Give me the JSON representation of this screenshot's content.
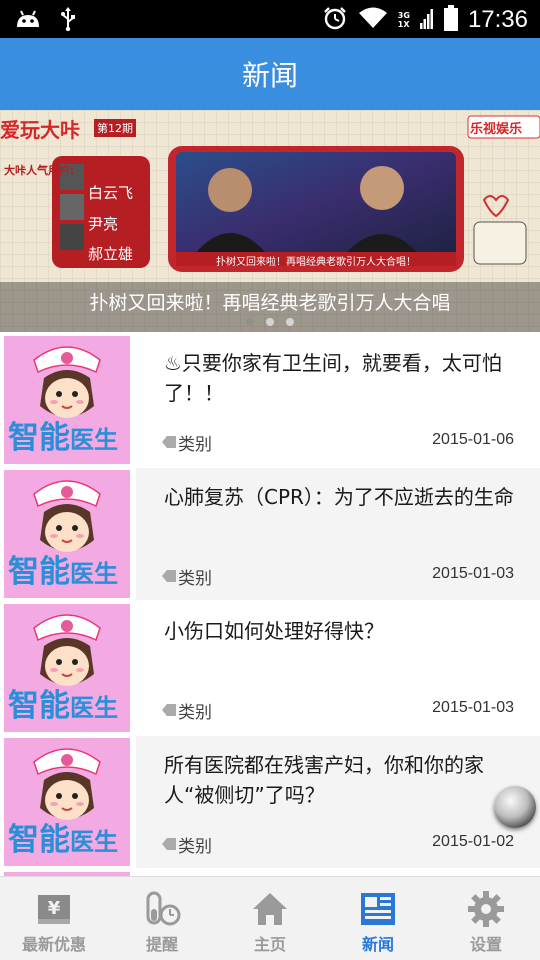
{
  "status_bar": {
    "time": "17:36",
    "network_label_top": "3G",
    "network_label_bottom": "1X"
  },
  "header": {
    "title": "新闻"
  },
  "banner": {
    "caption": "扑树又回来啦！再唱经典老歌引万人大合唱",
    "show_title": "爱玩大咔",
    "episode": "第12期",
    "brand": "乐视娱乐",
    "guests_label": "大咔人气用户:",
    "guests": [
      "白云飞",
      "尹亮",
      "郝立雄"
    ],
    "inner_caption": "扑树又回来啦！再唱经典老歌引万人大合唱！",
    "page_count": 3,
    "active_page": 1
  },
  "thumbnail_text": {
    "part1": "智能",
    "part2": "医生"
  },
  "news": [
    {
      "headline": "♨只要你家有卫生间，就要看，太可怕了！！",
      "tag": "类别",
      "date": "2015-01-06"
    },
    {
      "headline": "心肺复苏（CPR）：为了不应逝去的生命",
      "tag": "类别",
      "date": "2015-01-03"
    },
    {
      "headline": "小伤口如何处理好得快？",
      "tag": "类别",
      "date": "2015-01-03"
    },
    {
      "headline": "所有医院都在残害产妇，你和你的家人“被侧切”了吗？",
      "tag": "类别",
      "date": "2015-01-02"
    }
  ],
  "tabs": [
    {
      "label": "最新优惠",
      "icon": "yen-icon"
    },
    {
      "label": "提醒",
      "icon": "reminder-icon"
    },
    {
      "label": "主页",
      "icon": "home-icon"
    },
    {
      "label": "新闻",
      "icon": "news-icon",
      "active": true
    },
    {
      "label": "设置",
      "icon": "gear-icon"
    }
  ],
  "colors": {
    "accent": "#3a8ee0",
    "active_tab": "#2a77d6",
    "thumb_bg": "#f3a9e2"
  }
}
